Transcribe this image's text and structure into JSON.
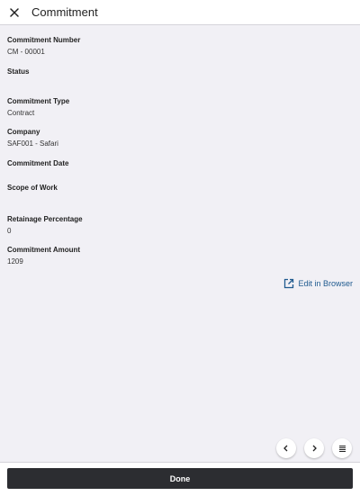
{
  "header": {
    "title": "Commitment",
    "close_icon": "close-icon"
  },
  "fields": [
    {
      "label": "Commitment Number",
      "value": "CM - 00001"
    },
    {
      "label": "Status",
      "value": ""
    },
    {
      "label": "Commitment Type",
      "value": "Contract"
    },
    {
      "label": "Company",
      "value": "SAF001 - Safari"
    },
    {
      "label": "Commitment Date",
      "value": ""
    },
    {
      "label": "Scope of Work",
      "value": ""
    },
    {
      "label": "Retainage Percentage",
      "value": "0"
    },
    {
      "label": "Commitment Amount",
      "value": "1209"
    }
  ],
  "actions": {
    "edit_in_browser": "Edit in Browser",
    "done": "Done"
  },
  "nav": {
    "previous_icon": "chevron-left-icon",
    "next_icon": "chevron-right-icon",
    "menu_icon": "list-icon"
  },
  "colors": {
    "background": "#f1f0f5",
    "link": "#1f5a8f",
    "done_button": "#2c2d31"
  }
}
